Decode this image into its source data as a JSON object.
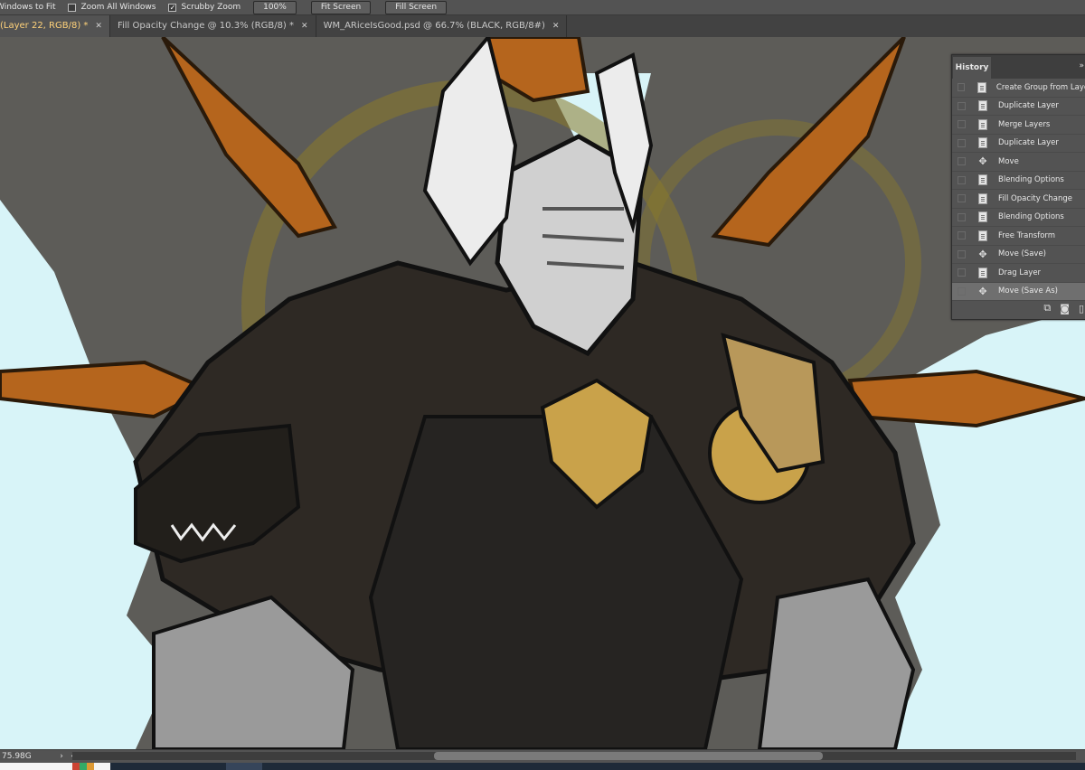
{
  "options_bar": {
    "items": [
      {
        "type": "check",
        "label": "Windows to Fit",
        "checked": false
      },
      {
        "type": "check",
        "label": "Zoom All Windows",
        "checked": false
      },
      {
        "type": "check",
        "label": "Scrubby Zoom",
        "checked": true
      }
    ],
    "buttons": [
      "100%",
      "Fit Screen",
      "Fill Screen"
    ]
  },
  "tabs": [
    {
      "label": "(Layer 22, RGB/8) *",
      "active": true
    },
    {
      "label": "Fill Opacity Change @ 10.3% (RGB/8) *",
      "active": false
    },
    {
      "label": "WM_ARiceIsGood.psd @ 66.7% (BLACK, RGB/8#)",
      "active": false
    }
  ],
  "history_panel": {
    "title": "History",
    "menu_icon": "panel-menu-icon",
    "items": [
      {
        "label": "Create Group from Layers",
        "icon": "document-icon",
        "selected": false
      },
      {
        "label": "Duplicate Layer",
        "icon": "document-icon",
        "selected": false
      },
      {
        "label": "Merge Layers",
        "icon": "document-icon",
        "selected": false
      },
      {
        "label": "Duplicate Layer",
        "icon": "document-icon",
        "selected": false
      },
      {
        "label": "Move",
        "icon": "move-icon",
        "selected": false
      },
      {
        "label": "Blending Options",
        "icon": "document-icon",
        "selected": false
      },
      {
        "label": "Fill Opacity Change",
        "icon": "document-icon",
        "selected": false
      },
      {
        "label": "Blending Options",
        "icon": "document-icon",
        "selected": false
      },
      {
        "label": "Free Transform",
        "icon": "document-icon",
        "selected": false
      },
      {
        "label": "Move (Save)",
        "icon": "move-icon",
        "selected": false
      },
      {
        "label": "Drag Layer",
        "icon": "document-icon",
        "selected": false
      },
      {
        "label": "Move (Save As)",
        "icon": "move-icon",
        "selected": true
      }
    ],
    "footer_icons": [
      "new-document-from-state-icon",
      "camera-snapshot-icon",
      "trash-icon"
    ]
  },
  "status_bar": {
    "doc_info": "75.98G"
  },
  "colors": {
    "panel_bg": "#535353",
    "canvas_bg": "#5d5c58",
    "accent_gold": "#c9a24a",
    "accent_orange": "#b5651d",
    "sky": "#d6f4f8"
  }
}
